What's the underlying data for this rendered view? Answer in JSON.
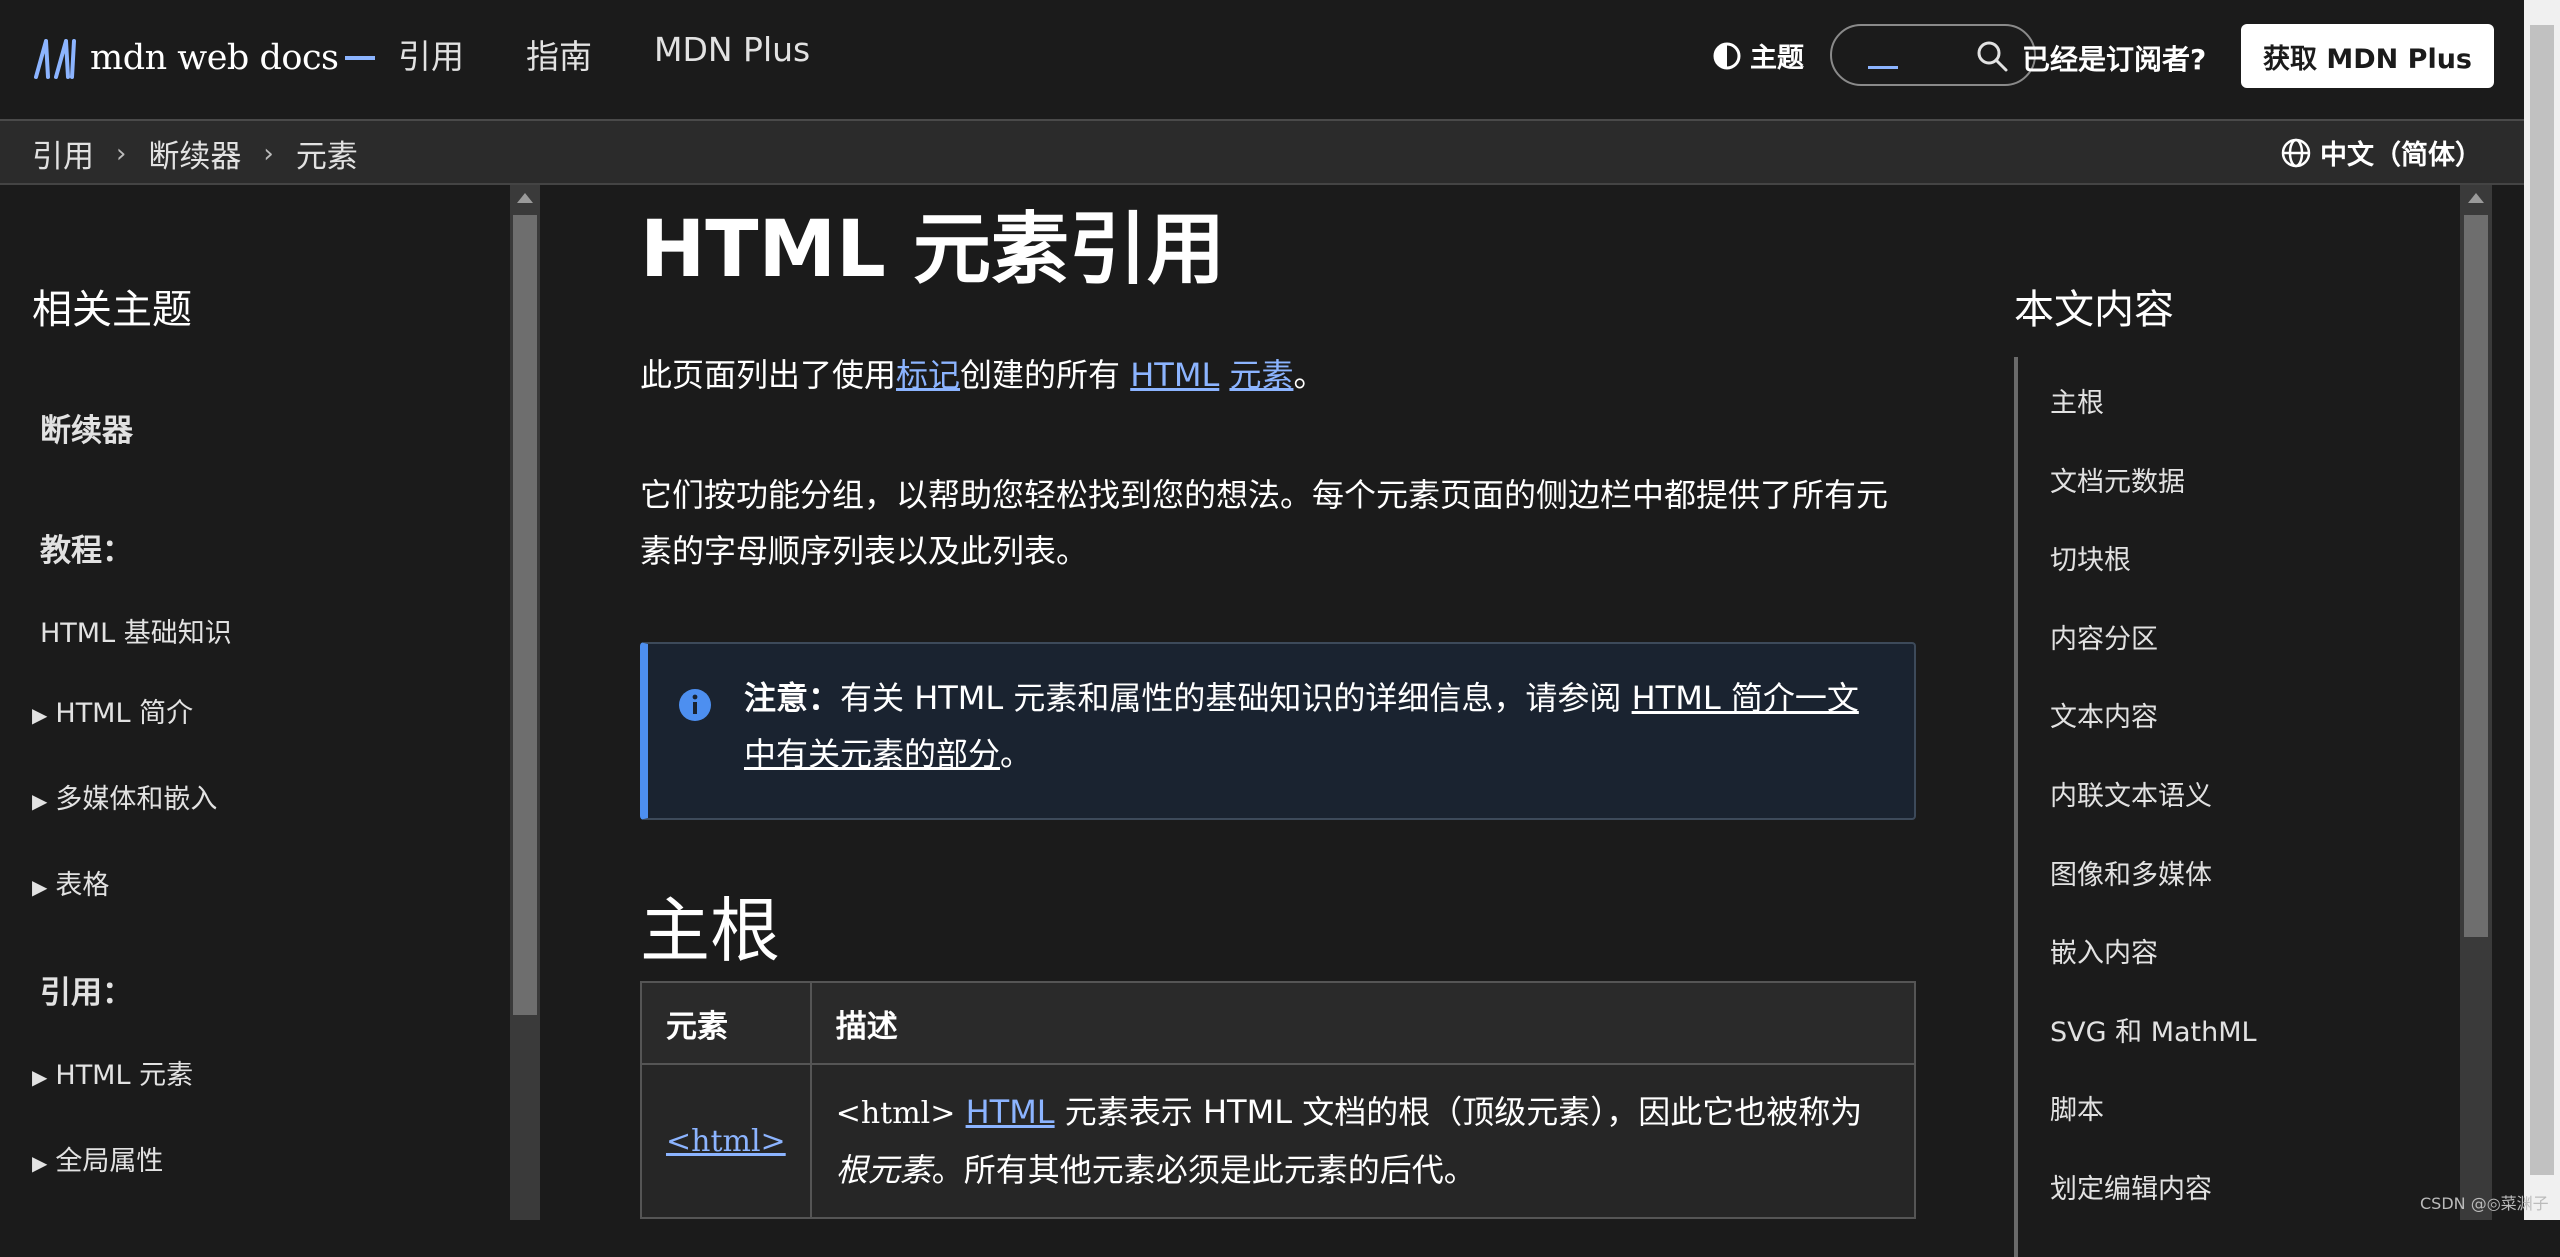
{
  "header": {
    "logo_text": "mdn web docs",
    "nav": [
      "引用",
      "指南",
      "MDN Plus"
    ],
    "theme_label": "主题",
    "search_placeholder": "",
    "subscriber_label": "已经是订阅者?",
    "plus_button": "获取 MDN Plus"
  },
  "breadcrumb": {
    "items": [
      "引用",
      "断续器",
      "元素"
    ],
    "separator": "›",
    "language": "中文（简体）"
  },
  "sidebar": {
    "title": "相关主题",
    "section1": "断续器",
    "tutorial_heading": "教程：",
    "html_basics": "HTML 基础知识",
    "html_intro": "HTML 简介",
    "multimedia": "多媒体和嵌入",
    "tables": "表格",
    "reference_heading": "引用：",
    "html_elements": "HTML 元素",
    "global_attrs": "全局属性",
    "expander": "▶"
  },
  "main": {
    "title": "HTML 元素引用",
    "p1_pre": "此页面列出了使用",
    "p1_link1": "标记",
    "p1_mid": "创建的所有 ",
    "p1_link2": "HTML",
    "p1_space": " ",
    "p1_link3": "元素",
    "p1_end": "。",
    "p2": "它们按功能分组，以帮助您轻松找到您的想法。每个元素页面的侧边栏中都提供了所有元素的字母顺序列表以及此列表。",
    "note_label": "注意：",
    "note_text": "有关 HTML 元素和属性的基础知识的详细信息，请参阅 ",
    "note_link": "HTML 简介一文中有关元素的部分",
    "note_end": "。",
    "h2": "主根",
    "table": {
      "headers": [
        "元素",
        "描述"
      ],
      "row_element": "<html>",
      "row_desc_code": "<html>",
      "row_desc_link": "HTML",
      "row_desc_text1": " 元素表示 HTML 文档的根（顶级元素），因此它也被称为",
      "row_desc_em": "根元素",
      "row_desc_text2": "。所有其他元素必须是此元素的后代。"
    }
  },
  "toc": {
    "title": "本文内容",
    "items": [
      "主根",
      "文档元数据",
      "切块根",
      "内容分区",
      "文本内容",
      "内联文本语义",
      "图像和多媒体",
      "嵌入内容",
      "SVG 和 MathML",
      "脚本",
      "划定编辑内容"
    ]
  },
  "watermark": "CSDN @◎菜渊子",
  "colors": {
    "background": "#1b1b1b",
    "link": "#8cb4ff",
    "note_accent": "#4d8ff0"
  }
}
